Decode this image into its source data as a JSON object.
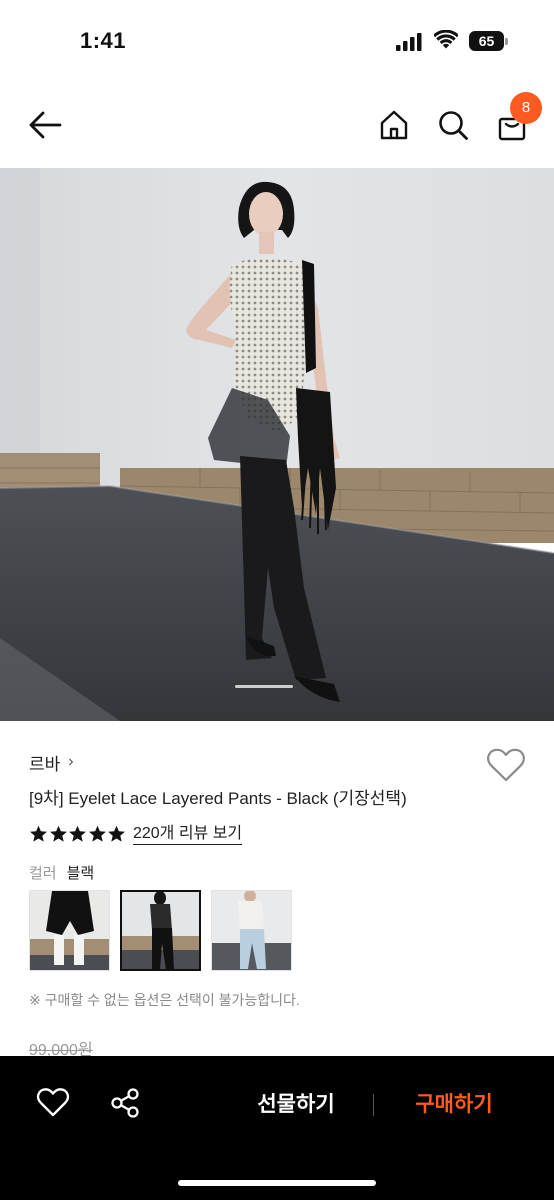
{
  "status_bar": {
    "time": "1:41",
    "battery": "65"
  },
  "header": {
    "back_icon": "arrow-left-icon",
    "home_icon": "home-icon",
    "search_icon": "search-icon",
    "bag_icon": "shopping-bag-icon",
    "cart_count": "8",
    "badge_color": "#ff5a1f"
  },
  "product": {
    "brand": "르바",
    "brand_chevron": "›",
    "title": "[9차] Eyelet Lace Layered Pants - Black (기장선택)",
    "rating": 5,
    "review_link": "220개 리뷰 보기",
    "option_name": "컬러",
    "option_value": "블랙",
    "swatches": [
      "white-shorts",
      "black-pants",
      "light-blue-pants"
    ],
    "selected_swatch": 1,
    "notice": "※ 구매할 수 없는 옵션은 선택이 불가능합니다.",
    "price_original": "99,000원"
  },
  "bottom_bar": {
    "like_icon": "heart-icon",
    "share_icon": "share-icon",
    "gift_label": "선물하기",
    "buy_label": "구매하기",
    "accent_color": "#ff5a1f"
  }
}
